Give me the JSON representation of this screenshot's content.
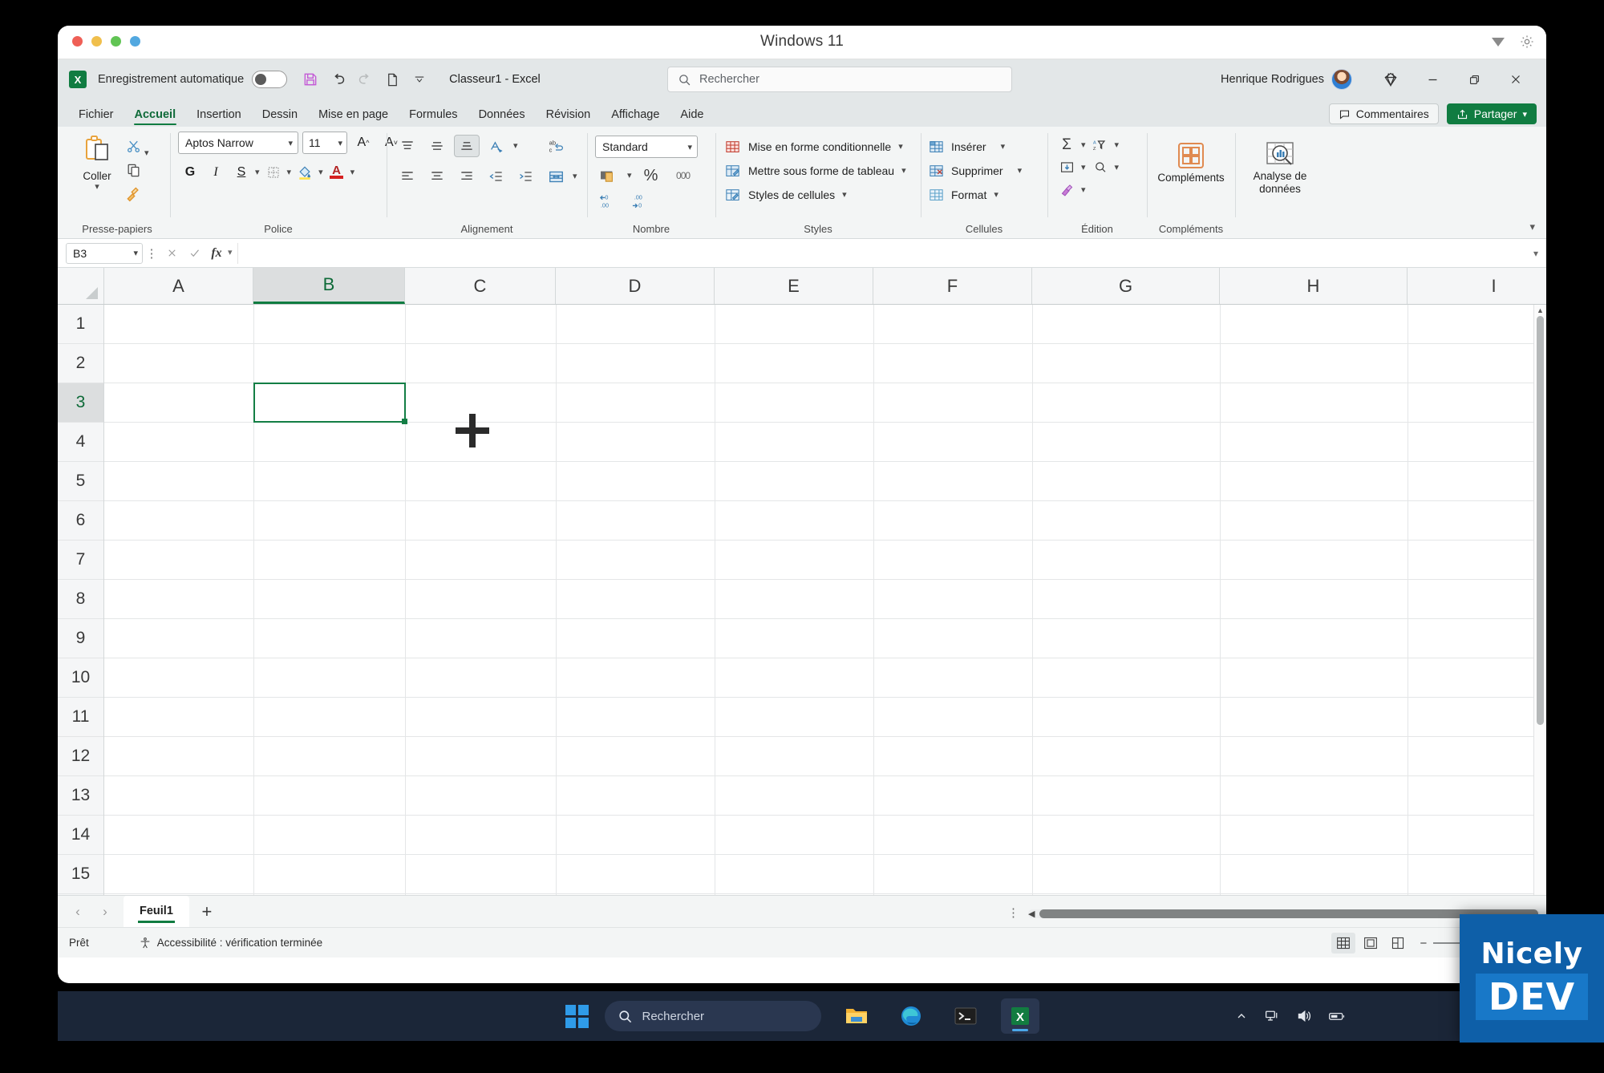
{
  "window": {
    "title": "Windows 11",
    "traffic_lights": [
      "close",
      "minimize",
      "zoom",
      "extra"
    ],
    "caret_icon": "triangle-down-icon",
    "gear_icon": "gear-icon"
  },
  "quick_access": {
    "app_icon": "excel-icon",
    "autosave_label": "Enregistrement automatique",
    "autosave_state": "off",
    "save_icon": "save-icon",
    "undo_icon": "undo-icon",
    "redo_icon": "redo-icon",
    "new_icon": "new-document-icon",
    "more_icon": "chevron-down-icon",
    "document_title": "Classeur1  -  Excel"
  },
  "search": {
    "icon": "search-icon",
    "placeholder": "Rechercher"
  },
  "account": {
    "user_name": "Henrique Rodrigues",
    "avatar": "user-avatar",
    "diamond_icon": "diamond-icon"
  },
  "window_controls": {
    "minimize": "minimize-icon",
    "restore": "restore-icon",
    "close": "close-icon"
  },
  "ribbon_tabs": {
    "items": [
      {
        "label": "Fichier",
        "active": false
      },
      {
        "label": "Accueil",
        "active": true
      },
      {
        "label": "Insertion",
        "active": false
      },
      {
        "label": "Dessin",
        "active": false
      },
      {
        "label": "Mise en page",
        "active": false
      },
      {
        "label": "Formules",
        "active": false
      },
      {
        "label": "Données",
        "active": false
      },
      {
        "label": "Révision",
        "active": false
      },
      {
        "label": "Affichage",
        "active": false
      },
      {
        "label": "Aide",
        "active": false
      }
    ],
    "comments_label": "Commentaires",
    "share_label": "Partager"
  },
  "ribbon": {
    "clipboard": {
      "group_label": "Presse-papiers",
      "paste_label": "Coller",
      "cut_icon": "scissors-icon",
      "copy_icon": "copy-icon",
      "format_painter_icon": "format-painter-icon"
    },
    "font": {
      "group_label": "Police",
      "font_family": "Aptos Narrow",
      "font_size": "11",
      "grow_font_icon": "increase-font-size-icon",
      "shrink_font_icon": "decrease-font-size-icon",
      "bold_label": "G",
      "italic_label": "I",
      "underline_label": "S",
      "borders_icon": "borders-icon",
      "fill_color_icon": "fill-color-icon",
      "font_color_icon": "font-color-icon"
    },
    "alignment": {
      "group_label": "Alignement",
      "align_top_icon": "align-top-icon",
      "align_middle_icon": "align-middle-icon",
      "align_bottom_icon": "align-bottom-icon",
      "orientation_icon": "text-orientation-icon",
      "wrap_text_icon": "wrap-text-icon",
      "align_left_icon": "align-left-icon",
      "align_center_icon": "align-center-icon",
      "align_right_icon": "align-right-icon",
      "decrease_indent_icon": "decrease-indent-icon",
      "increase_indent_icon": "increase-indent-icon",
      "merge_cells_icon": "merge-and-center-icon"
    },
    "number": {
      "group_label": "Nombre",
      "format": "Standard",
      "accounting_icon": "accounting-format-icon",
      "percent_icon": "percent-style-icon",
      "comma_icon": "comma-style-icon",
      "increase_decimal_icon": "increase-decimal-icon",
      "decrease_decimal_icon": "decrease-decimal-icon"
    },
    "styles": {
      "group_label": "Styles",
      "items": [
        {
          "label": "Mise en forme conditionnelle",
          "icon": "conditional-formatting-icon"
        },
        {
          "label": "Mettre sous forme de tableau",
          "icon": "format-as-table-icon"
        },
        {
          "label": "Styles de cellules",
          "icon": "cell-styles-icon"
        }
      ]
    },
    "cells": {
      "group_label": "Cellules",
      "items": [
        {
          "label": "Insérer",
          "icon": "insert-cells-icon"
        },
        {
          "label": "Supprimer",
          "icon": "delete-cells-icon"
        },
        {
          "label": "Format",
          "icon": "format-cells-icon"
        }
      ]
    },
    "editing": {
      "group_label": "Édition",
      "autosum_icon": "autosum-icon",
      "sort_filter_icon": "sort-and-filter-icon",
      "fill_icon": "fill-icon",
      "find_select_icon": "find-and-select-icon",
      "clear_icon": "clear-icon"
    },
    "addins": {
      "group_label": "Compléments",
      "addins_label": "Compléments",
      "addins_icon": "addins-grid-icon"
    },
    "analysis": {
      "label": "Analyse de données",
      "icon": "data-analysis-icon"
    },
    "collapse_icon": "chevron-up-icon"
  },
  "formula_bar": {
    "name_box": "B3",
    "cancel_icon": "cancel-icon",
    "confirm_icon": "confirm-icon",
    "function_icon": "insert-function-icon",
    "value": "",
    "expand_icon": "chevron-down-icon"
  },
  "grid": {
    "columns": [
      "A",
      "B",
      "C",
      "D",
      "E",
      "F",
      "G",
      "H",
      "I"
    ],
    "rows": [
      "1",
      "2",
      "3",
      "4",
      "5",
      "6",
      "7",
      "8",
      "9",
      "10",
      "11",
      "12",
      "13",
      "14",
      "15"
    ],
    "selected_cell": "B3",
    "selected_column": "B",
    "selected_row": "3",
    "cursor_icon": "cell-selection-plus-cursor"
  },
  "sheet_bar": {
    "prev_icon": "chevron-left-icon",
    "next_icon": "chevron-right-icon",
    "tabs": [
      {
        "label": "Feuil1",
        "active": true
      }
    ],
    "add_sheet_icon": "plus-icon",
    "more_icon": "vertical-dots-icon"
  },
  "status_bar": {
    "state": "Prêt",
    "accessibility": "Accessibilité : vérification terminée",
    "accessibility_icon": "accessibility-icon",
    "views": [
      {
        "name": "normal-view",
        "icon": "grid-view-icon",
        "selected": true
      },
      {
        "name": "page-layout-view",
        "icon": "page-layout-icon",
        "selected": false
      },
      {
        "name": "page-break-view",
        "icon": "page-break-icon",
        "selected": false
      }
    ],
    "zoom_out": "−",
    "zoom_in": "+"
  },
  "taskbar": {
    "start_icon": "windows-start-icon",
    "search_placeholder": "Rechercher",
    "search_icon": "search-icon",
    "apps": [
      {
        "name": "file-explorer-icon",
        "active": false
      },
      {
        "name": "microsoft-edge-icon",
        "active": false
      },
      {
        "name": "terminal-icon",
        "active": false
      },
      {
        "name": "excel-icon",
        "active": true
      }
    ],
    "tray": [
      {
        "name": "show-hidden-icons-chevron"
      },
      {
        "name": "network-icon"
      },
      {
        "name": "volume-icon"
      },
      {
        "name": "battery-icon"
      }
    ]
  },
  "watermark": {
    "top": "Nicely",
    "bottom": "DEV",
    "color": "#0e5fa8"
  },
  "colors": {
    "excel_green": "#107c41",
    "ribbon_bg": "#f3f5f5",
    "chrome_bg": "#e3e7e8",
    "taskbar_bg": "#1b2638"
  }
}
